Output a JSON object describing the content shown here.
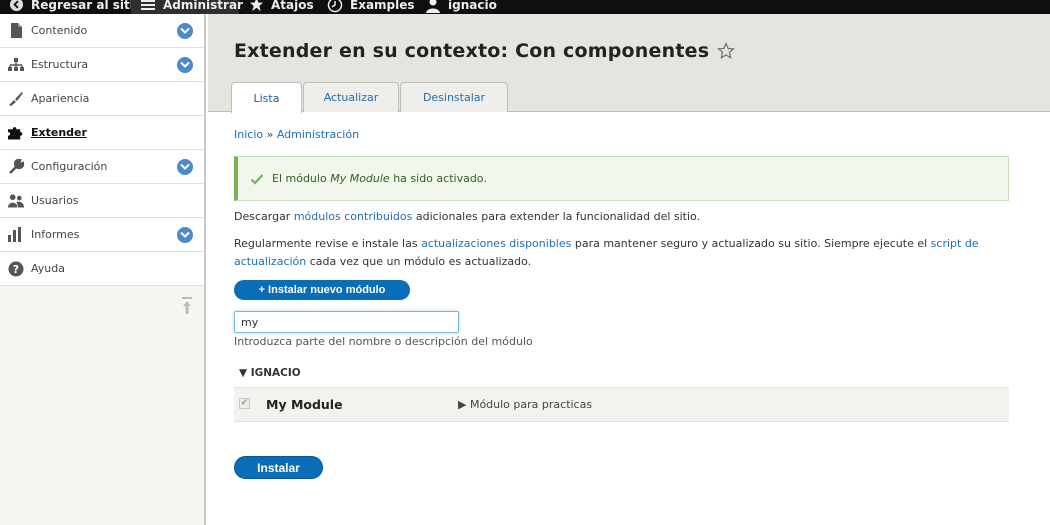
{
  "toolbar": {
    "items": [
      {
        "label": "Regresar al sitio",
        "icon": "back-arrow-icon"
      },
      {
        "label": "Administrar",
        "icon": "menu-icon"
      },
      {
        "label": "Atajos",
        "icon": "star-icon"
      },
      {
        "label": "Examples",
        "icon": "clock-icon"
      },
      {
        "label": "ignacio",
        "icon": "user-icon"
      }
    ]
  },
  "sidebar": {
    "items": [
      {
        "label": "Contenido",
        "icon": "file-icon",
        "expandable": true
      },
      {
        "label": "Estructura",
        "icon": "sitemap-icon",
        "expandable": true
      },
      {
        "label": "Apariencia",
        "icon": "paint-brush-icon",
        "expandable": false
      },
      {
        "label": "Extender",
        "icon": "puzzle-icon",
        "expandable": false,
        "active": true
      },
      {
        "label": "Configuración",
        "icon": "wrench-icon",
        "expandable": true
      },
      {
        "label": "Usuarios",
        "icon": "users-icon",
        "expandable": false
      },
      {
        "label": "Informes",
        "icon": "bar-chart-icon",
        "expandable": true
      },
      {
        "label": "Ayuda",
        "icon": "help-icon",
        "expandable": false
      }
    ]
  },
  "header": {
    "title": "Extender en su contexto: Con componentes",
    "tabs": [
      {
        "label": "Lista",
        "active": true
      },
      {
        "label": "Actualizar",
        "active": false
      },
      {
        "label": "Desinstalar",
        "active": false
      }
    ]
  },
  "breadcrumb": {
    "home": "Inicio",
    "separator": "»",
    "admin": "Administración"
  },
  "message": {
    "prefix": "El módulo",
    "module": "My Module",
    "suffix": "ha sido activado."
  },
  "intro": {
    "p1_before": "Descargar",
    "p1_link": "módulos contribuidos",
    "p1_after": "adicionales para extender la funcionalidad del sitio.",
    "p2_before": "Regularmente revise e instale las",
    "p2_link1": "actualizaciones disponibles",
    "p2_middle": "para mantener seguro y actualizado su sitio. Siempre ejecute el",
    "p2_link2": "script de actualización",
    "p2_after": "cada vez que un módulo es actualizado."
  },
  "install_new_label": "+ Instalar nuevo módulo",
  "filter": {
    "value": "my",
    "description": "Introduzca parte del nombre o descripción del módulo"
  },
  "package": {
    "title": "▼ IGNACIO",
    "module": {
      "name": "My Module",
      "description": "▶ Módulo para practicas",
      "enabled": true
    }
  },
  "install_label": "Instalar",
  "colors": {
    "accent": "#0a6db8",
    "link": "#1f6fb2",
    "toolbar_bg": "#0f0f0f",
    "success": "#77b259"
  }
}
